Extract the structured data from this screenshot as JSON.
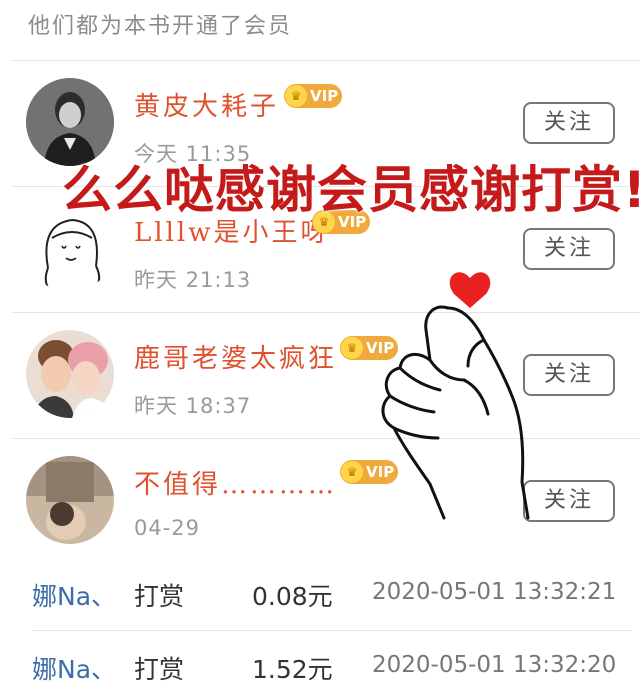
{
  "header": {
    "title": "他们都为本书开通了会员"
  },
  "members": [
    {
      "name": "黄皮大耗子",
      "badge": "VIP",
      "time": "今天 11:35",
      "follow_label": "关注"
    },
    {
      "name": "Llllw是小王呀",
      "badge": "VIP",
      "time": "昨天 21:13",
      "follow_label": "关注"
    },
    {
      "name": "鹿哥老婆太疯狂",
      "badge": "VIP",
      "time": "昨天 18:37",
      "follow_label": "关注"
    },
    {
      "name": "不值得…………",
      "badge": "VIP",
      "time": "04-29",
      "follow_label": "关注"
    }
  ],
  "rewards": [
    {
      "user": "娜Na、",
      "action": "打赏",
      "amount": "0.08元",
      "date": "2020-05-01 13:32:21"
    },
    {
      "user": "娜Na、",
      "action": "打赏",
      "amount": "1.52元",
      "date": "2020-05-01 13:32:20"
    }
  ],
  "overlay": {
    "text": "么么哒感谢会员感谢打赏!"
  },
  "colors": {
    "member_name": "#e0522f",
    "vip_badge": "#f0a93d",
    "reward_user": "#3b6da8",
    "overlay_text": "#c41a1a",
    "heart": "#e82020"
  },
  "icons": {
    "vip": "crown-icon",
    "sticker": "finger-heart-icon"
  }
}
